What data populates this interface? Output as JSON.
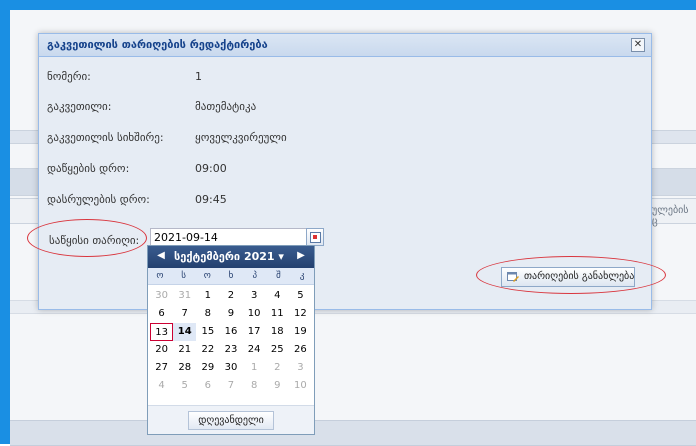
{
  "background": {
    "peek_text": "ულების ც"
  },
  "modal": {
    "title": "გაკვეთილის თარიღების რედაქტირება",
    "close_glyph": "✕",
    "rows": [
      {
        "label": "ნომერი:",
        "value": "1"
      },
      {
        "label": "გაკვეთილი:",
        "value": "მათემატიკა"
      },
      {
        "label": "გაკვეთილის სიხშირე:",
        "value": "ყოველკვირეული"
      },
      {
        "label": "დაწყების დრო:",
        "value": "09:00"
      },
      {
        "label": "დასრულების დრო:",
        "value": "09:45"
      }
    ],
    "start_date": {
      "label": "საწყისი თარიღი:",
      "value": "2021-09-14"
    },
    "update_button": "თარიღების განახლება"
  },
  "calendar": {
    "prev": "◀",
    "next": "▶",
    "month": "სექტემბერი 2021 ▾",
    "weekdays": [
      "ო",
      "ს",
      "ო",
      "ხ",
      "პ",
      "შ",
      "კ"
    ],
    "days": [
      {
        "d": "30",
        "other": true
      },
      {
        "d": "31",
        "other": true
      },
      {
        "d": "1"
      },
      {
        "d": "2"
      },
      {
        "d": "3"
      },
      {
        "d": "4"
      },
      {
        "d": "5"
      },
      {
        "d": "6"
      },
      {
        "d": "7"
      },
      {
        "d": "8"
      },
      {
        "d": "9"
      },
      {
        "d": "10"
      },
      {
        "d": "11"
      },
      {
        "d": "12"
      },
      {
        "d": "13",
        "today": true
      },
      {
        "d": "14",
        "selected": true
      },
      {
        "d": "15"
      },
      {
        "d": "16"
      },
      {
        "d": "17"
      },
      {
        "d": "18"
      },
      {
        "d": "19"
      },
      {
        "d": "20"
      },
      {
        "d": "21"
      },
      {
        "d": "22"
      },
      {
        "d": "23"
      },
      {
        "d": "24"
      },
      {
        "d": "25"
      },
      {
        "d": "26"
      },
      {
        "d": "27"
      },
      {
        "d": "28"
      },
      {
        "d": "29"
      },
      {
        "d": "30"
      },
      {
        "d": "1",
        "other": true
      },
      {
        "d": "2",
        "other": true
      },
      {
        "d": "3",
        "other": true
      },
      {
        "d": "4",
        "other": true
      },
      {
        "d": "5",
        "other": true
      },
      {
        "d": "6",
        "other": true
      },
      {
        "d": "7",
        "other": true
      },
      {
        "d": "8",
        "other": true
      },
      {
        "d": "9",
        "other": true
      },
      {
        "d": "10",
        "other": true
      }
    ],
    "today_button": "დღევანდელი"
  },
  "colors": {
    "frame_blue": "#1a8fe3",
    "annotation_red": "#d9363e",
    "calendar_header": "#2c4a7c"
  }
}
